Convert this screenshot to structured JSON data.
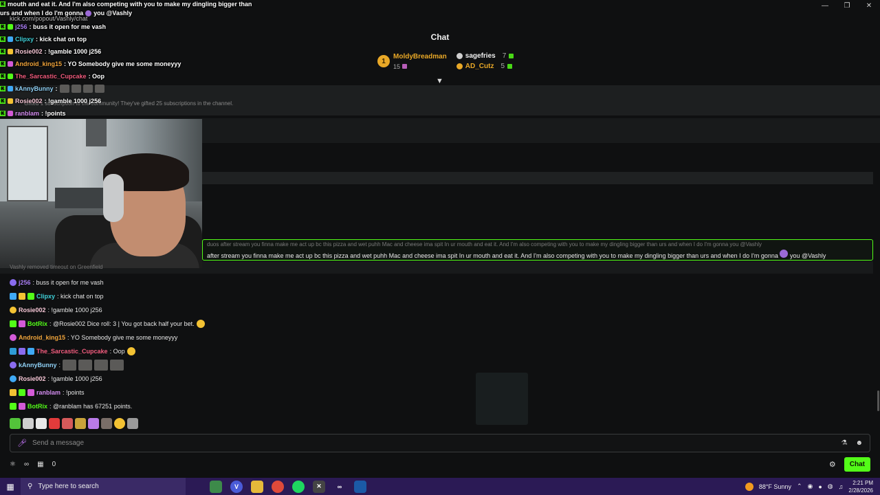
{
  "window": {
    "url": "kick.com/popout/Vashly/chat"
  },
  "header": {
    "title": "Chat",
    "leaderboard": {
      "first": {
        "rank": "1",
        "name": "MoldyBreadman",
        "count": "15"
      },
      "second": {
        "name": "sagefries",
        "count": "7"
      },
      "third": {
        "name": "AD_Cutz",
        "count": "5"
      }
    }
  },
  "overlay_chat": {
    "line0a": "mouth and eat it. And I'm also competing with you to make my dingling bigger than",
    "line0b": "urs and when I do I'm gonna",
    "line0c": "you @Vashly",
    "lines": [
      {
        "name": "j256",
        "text": ": buss it open for me vash",
        "color": "#a77cf0"
      },
      {
        "name": "Clipxy",
        "text": ": kick chat on top",
        "color": "#3fd0d8"
      },
      {
        "name": "Rosie002",
        "text": ": !gamble 1000 j256",
        "color": "#f4c5d4"
      },
      {
        "name": "Android_king15",
        "text": ": YO Somebody give me some moneyyy",
        "color": "#f0a43b"
      },
      {
        "name": "The_Sarcastic_Cupcake",
        "text": ": Oop",
        "color": "#f25c7e"
      },
      {
        "name": "kAnnyBunny",
        "text": ":",
        "color": "#8fd0f5"
      },
      {
        "name": "Rosie002",
        "text": ": !gamble 1000 j256",
        "color": "#f4c5d4"
      },
      {
        "name": "ranblam",
        "text": ": !points",
        "color": "#d38cf0"
      }
    ],
    "ranblam_tag": "ranblam"
  },
  "band_text": "Gifted 1 subscription to the community! They've gifted 25 subscriptions in the channel.",
  "pinned": {
    "top": "duos after stream you finna make me act up bc this pizza and wet puhh Mac and cheese ima spit In ur mouth and eat it. And I'm also competing with you to make my dingling bigger than urs and when I do I'm gonna  you @Vashly",
    "main": "after stream you finna make me act up bc this pizza and wet puhh Mac and cheese ima spit In ur mouth and eat it. And I'm also competing with you to make my dingling bigger than urs and when I do I'm gonna",
    "tail": "you @Vashly"
  },
  "timeout_text": "Vashly removed timeout on Greenfield",
  "chat": [
    {
      "name": "j256",
      "text": ": buss it open for me vash",
      "color": "#a77cf0"
    },
    {
      "name": "Clipxy",
      "text": ": kick chat on top",
      "color": "#3fd0d8"
    },
    {
      "name": "Rosie002",
      "text": ": !gamble 1000 j256",
      "color": "#f4c5d4"
    },
    {
      "name": "BotRix",
      "text": ": @Rosie002 Dice roll: 3 | You got back half your bet.",
      "color": "#53fc18"
    },
    {
      "name": "Android_king15",
      "text": ": YO Somebody give me some moneyyy",
      "color": "#f0a43b"
    },
    {
      "name": "The_Sarcastic_Cupcake",
      "text": ": Oop",
      "color": "#f25c7e"
    },
    {
      "name": "kAnnyBunny",
      "text": ":",
      "color": "#8fd0f5"
    },
    {
      "name": "Rosie002",
      "text": ": !gamble 1000 j256",
      "color": "#f4c5d4"
    },
    {
      "name": "ranblam",
      "text": ": !points",
      "color": "#d38cf0"
    },
    {
      "name": "BotRix",
      "text": ": @ranblam has 67251 points.",
      "color": "#53fc18"
    }
  ],
  "input": {
    "placeholder": "Send a message"
  },
  "bottom": {
    "points": "0",
    "chat_button": "Chat"
  },
  "taskbar": {
    "search_placeholder": "Type here to search",
    "weather": "88°F  Sunny",
    "time": "2:21 PM",
    "date": "2/28/2026"
  },
  "colors": {
    "accent": "#53fc18",
    "taskbar": "#2b1a55"
  }
}
